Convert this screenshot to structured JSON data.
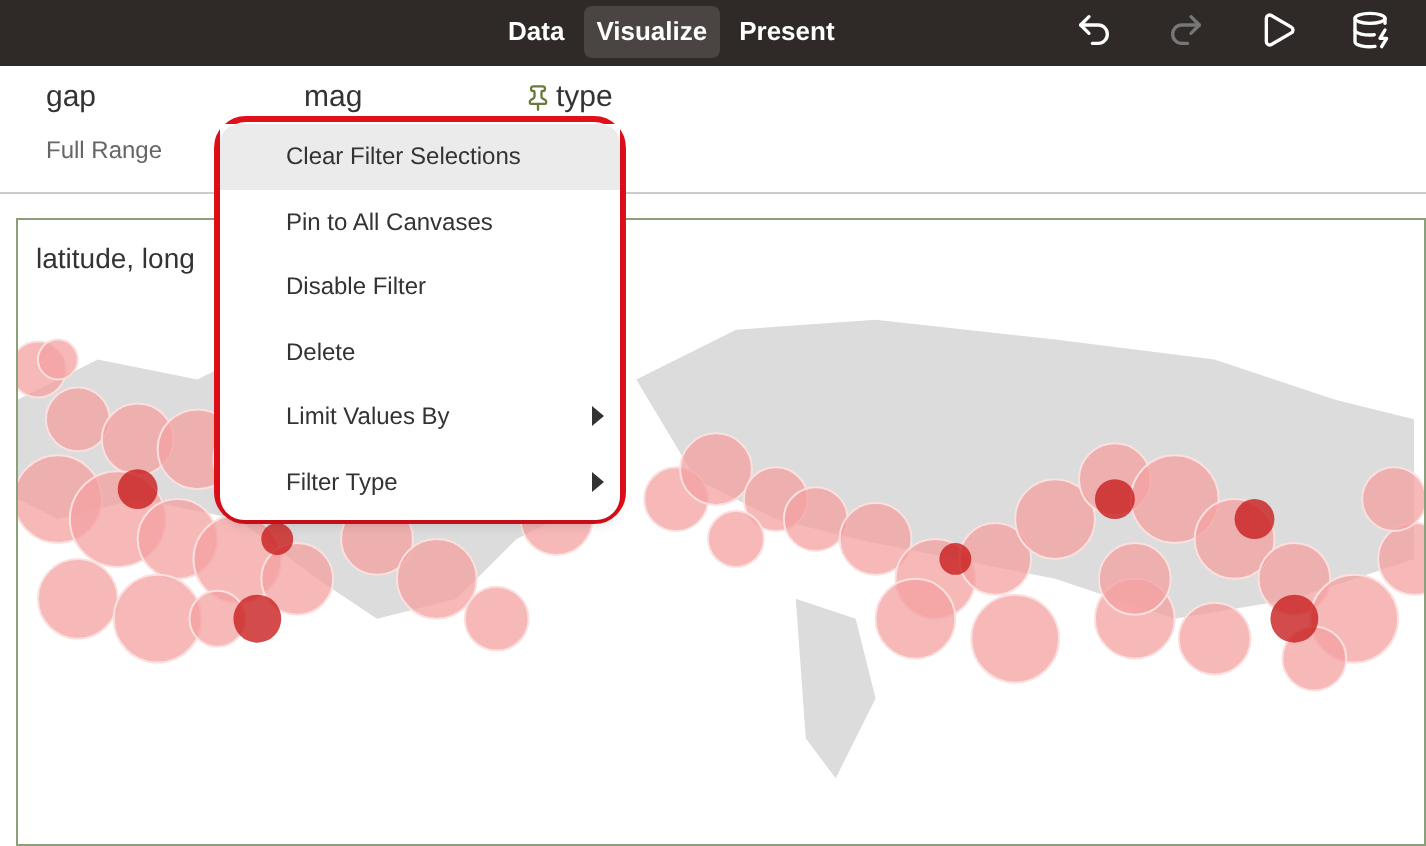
{
  "toolbar": {
    "tabs": [
      {
        "label": "Data",
        "selected": false
      },
      {
        "label": "Visualize",
        "selected": true
      },
      {
        "label": "Present",
        "selected": false
      }
    ]
  },
  "filters": [
    {
      "name": "gap",
      "value": "Full Range",
      "pinned": false
    },
    {
      "name": "mag",
      "pinned": false
    },
    {
      "name": "type",
      "pinned": true
    }
  ],
  "visualization": {
    "title": "latitude, long"
  },
  "context_menu": {
    "items": [
      {
        "label": "Clear Filter Selections",
        "kind": "action",
        "selected": true
      },
      {
        "label": "Pin to All Canvases",
        "kind": "action",
        "selected": false
      },
      {
        "label": "Disable Filter",
        "kind": "action",
        "selected": false
      },
      {
        "label": "Delete",
        "kind": "action",
        "selected": false
      },
      {
        "label": "Limit Values By",
        "kind": "submenu",
        "selected": false
      },
      {
        "label": "Filter Type",
        "kind": "submenu",
        "selected": false
      }
    ]
  }
}
